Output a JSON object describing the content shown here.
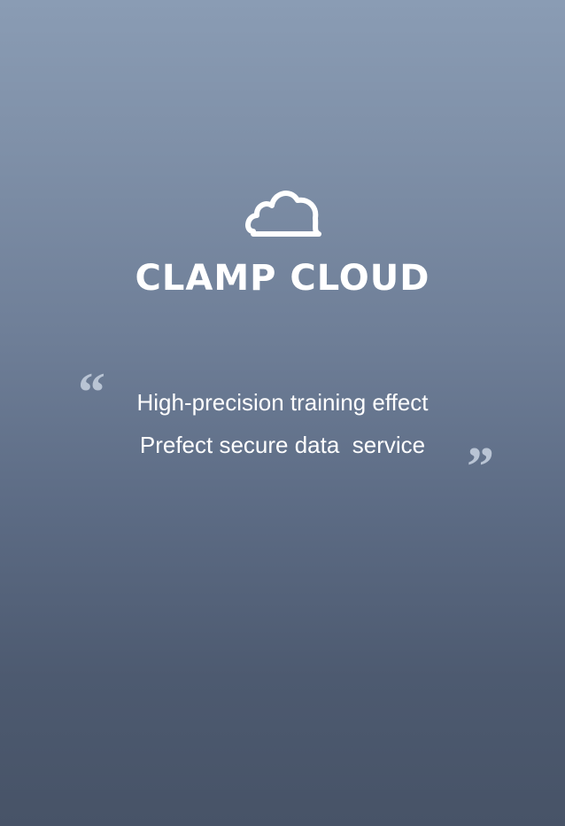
{
  "splash": {
    "brand_name": "CLAMP CLOUD",
    "logo_icon": "cloud-icon",
    "quote_open": "“",
    "quote_close": "”",
    "tagline_lines": [
      "High-precision training effect",
      "Prefect secure data  service"
    ]
  },
  "colors": {
    "background_top": "#8a9cb4",
    "background_bottom": "#475367",
    "text": "#ffffff",
    "quote_marks": "#b9c4d4"
  }
}
